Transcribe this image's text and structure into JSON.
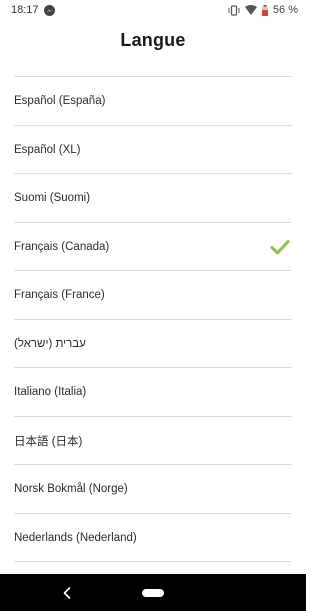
{
  "status_bar": {
    "time": "18:17",
    "battery_percent": "56 %",
    "icons": [
      "messenger-icon",
      "vibrate-icon",
      "wifi-icon",
      "battery-icon"
    ]
  },
  "header": {
    "title": "Langue"
  },
  "languages": {
    "items": [
      {
        "label": ""
      },
      {
        "label": "Español (España)"
      },
      {
        "label": "Español (XL)"
      },
      {
        "label": "Suomi (Suomi)"
      },
      {
        "label": "Français (Canada)",
        "selected": true
      },
      {
        "label": "Français (France)"
      },
      {
        "label": "עברית (ישראל)"
      },
      {
        "label": "Italiano (Italia)"
      },
      {
        "label": "日本語 (日本)"
      },
      {
        "label": "Norsk Bokmål (Norge)"
      },
      {
        "label": "Nederlands (Nederland)"
      }
    ]
  },
  "colors": {
    "accent_check": "#8bc34a",
    "divider": "#dcdcdc",
    "nav_bar": "#000000"
  },
  "nav_bar": {
    "icons": [
      "back-icon",
      "home-icon"
    ]
  }
}
